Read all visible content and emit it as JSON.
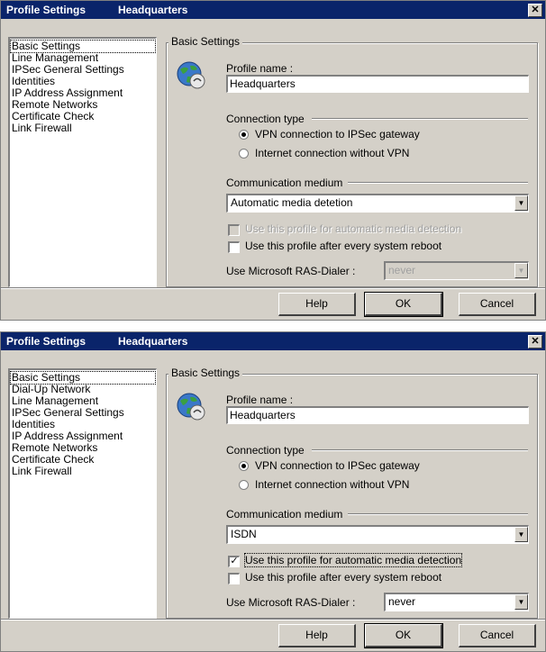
{
  "dialogs": [
    {
      "title": "Profile Settings",
      "subtitle": "Headquarters",
      "close_glyph": "✕",
      "nav_items": [
        "Basic Settings",
        "Line Management",
        "IPSec General Settings",
        "Identities",
        "IP Address Assignment",
        "Remote Networks",
        "Certificate Check",
        "Link Firewall"
      ],
      "selected_nav": "Basic Settings",
      "panel_title": "Basic Settings",
      "profile_name_label": "Profile name :",
      "profile_name_value": "Headquarters",
      "connection_type_label": "Connection type",
      "radio_vpn": "VPN connection to IPSec gateway",
      "radio_internet": "Internet connection without VPN",
      "comm_medium_label": "Communication medium",
      "comm_medium_value": "Automatic media detetion",
      "check_auto_media": "Use this profile for automatic media detection",
      "check_auto_media_checked": false,
      "check_reboot": "Use this profile after every system reboot",
      "check_reboot_checked": false,
      "ras_label": "Use Microsoft RAS-Dialer :",
      "ras_value": "never",
      "btn_help": "Help",
      "btn_ok": "OK",
      "btn_cancel": "Cancel"
    },
    {
      "title": "Profile Settings",
      "subtitle": "Headquarters",
      "close_glyph": "✕",
      "nav_items": [
        "Basic Settings",
        "Dial-Up Network",
        "Line Management",
        "IPSec General Settings",
        "Identities",
        "IP Address Assignment",
        "Remote Networks",
        "Certificate Check",
        "Link Firewall"
      ],
      "selected_nav": "Basic Settings",
      "panel_title": "Basic Settings",
      "profile_name_label": "Profile name :",
      "profile_name_value": "Headquarters",
      "connection_type_label": "Connection type",
      "radio_vpn": "VPN connection to IPSec gateway",
      "radio_internet": "Internet connection without VPN",
      "comm_medium_label": "Communication medium",
      "comm_medium_value": "ISDN",
      "check_auto_media": "Use this profile for automatic media detection",
      "check_auto_media_checked": true,
      "check_reboot": "Use this profile after every system reboot",
      "check_reboot_checked": false,
      "ras_label": "Use Microsoft RAS-Dialer :",
      "ras_value": "never",
      "btn_help": "Help",
      "btn_ok": "OK",
      "btn_cancel": "Cancel"
    }
  ],
  "icons": {
    "globe": "globe-network-icon",
    "dropdown_arrow": "▼",
    "check_mark": "✓"
  }
}
